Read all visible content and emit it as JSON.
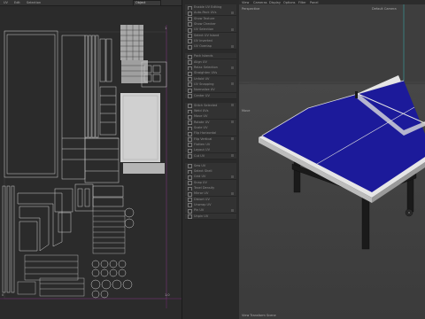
{
  "uv_editor": {
    "menu": [
      "UV",
      "Edit",
      "Selection"
    ],
    "dropdown_value": "Object",
    "ruler_top": "1",
    "ruler_bottom": "1.0",
    "ruler_left": "0"
  },
  "attributes": {
    "rows": [
      "Enable UV Editing",
      "Auto-Pack UVs",
      "Show Texture",
      "Show Checker",
      "UV Selection",
      "Select UV Island",
      "UV Inverted",
      "UV Overlap",
      "Pack Islands",
      "Align UV",
      "Relax Selection",
      "Straighten UVs",
      "Unfold UV",
      "UV Snapping",
      "Normalize UV",
      "Center UV",
      "Stitch Selected",
      "Weld UVs",
      "Move UV",
      "Rotate UV",
      "Scale UV",
      "Flip Horizontal",
      "Flip Vertical",
      "Flatten UV",
      "Layout UV",
      "Cut UV",
      "Sew UV",
      "Select Shell",
      "Grid UV",
      "Snap UV",
      "Texel Density",
      "Mirror UV",
      "Distort UV",
      "Unwrap UV",
      "Pin UV",
      "Unpin UV"
    ]
  },
  "viewport": {
    "menu": [
      "View",
      "Cameras",
      "Display",
      "Options",
      "Filter",
      "Panel"
    ],
    "label_perspective": "Perspective",
    "label_camera": "Default Camera",
    "label_move": "Move",
    "label_status": "View Transform Scene",
    "colors": {
      "table_top": "#1c1a9a",
      "table_edge": "#e8e8e8",
      "background": "#3e3e3e"
    }
  }
}
